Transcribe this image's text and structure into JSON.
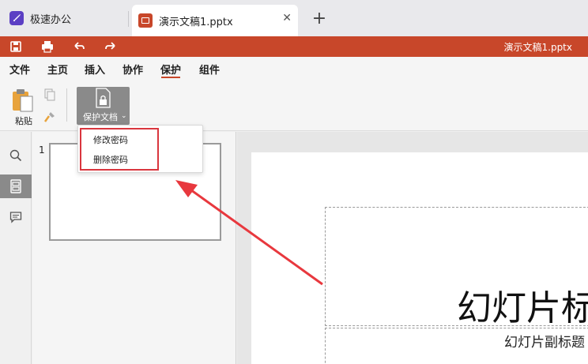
{
  "tabs": [
    {
      "label": "极速办公",
      "icon": "rocket-app-icon"
    },
    {
      "label": "演示文稿1.pptx",
      "icon": "presentation-doc-icon",
      "active": true
    }
  ],
  "quickbar": {
    "title": "演示文稿1.pptx",
    "color": "#c8472a"
  },
  "menu": {
    "items": [
      "文件",
      "主页",
      "插入",
      "协作",
      "保护",
      "组件"
    ],
    "active": "保护"
  },
  "ribbon": {
    "paste_label": "粘贴",
    "protect_label": "保护文档"
  },
  "dropdown": {
    "items": [
      "修改密码",
      "删除密码"
    ]
  },
  "thumbnails": [
    {
      "number": "1"
    }
  ],
  "slide": {
    "title": "幻灯片标",
    "subtitle": "幻灯片副标题"
  },
  "colors": {
    "accent": "#c8472a",
    "highlight": "#d9363e"
  }
}
